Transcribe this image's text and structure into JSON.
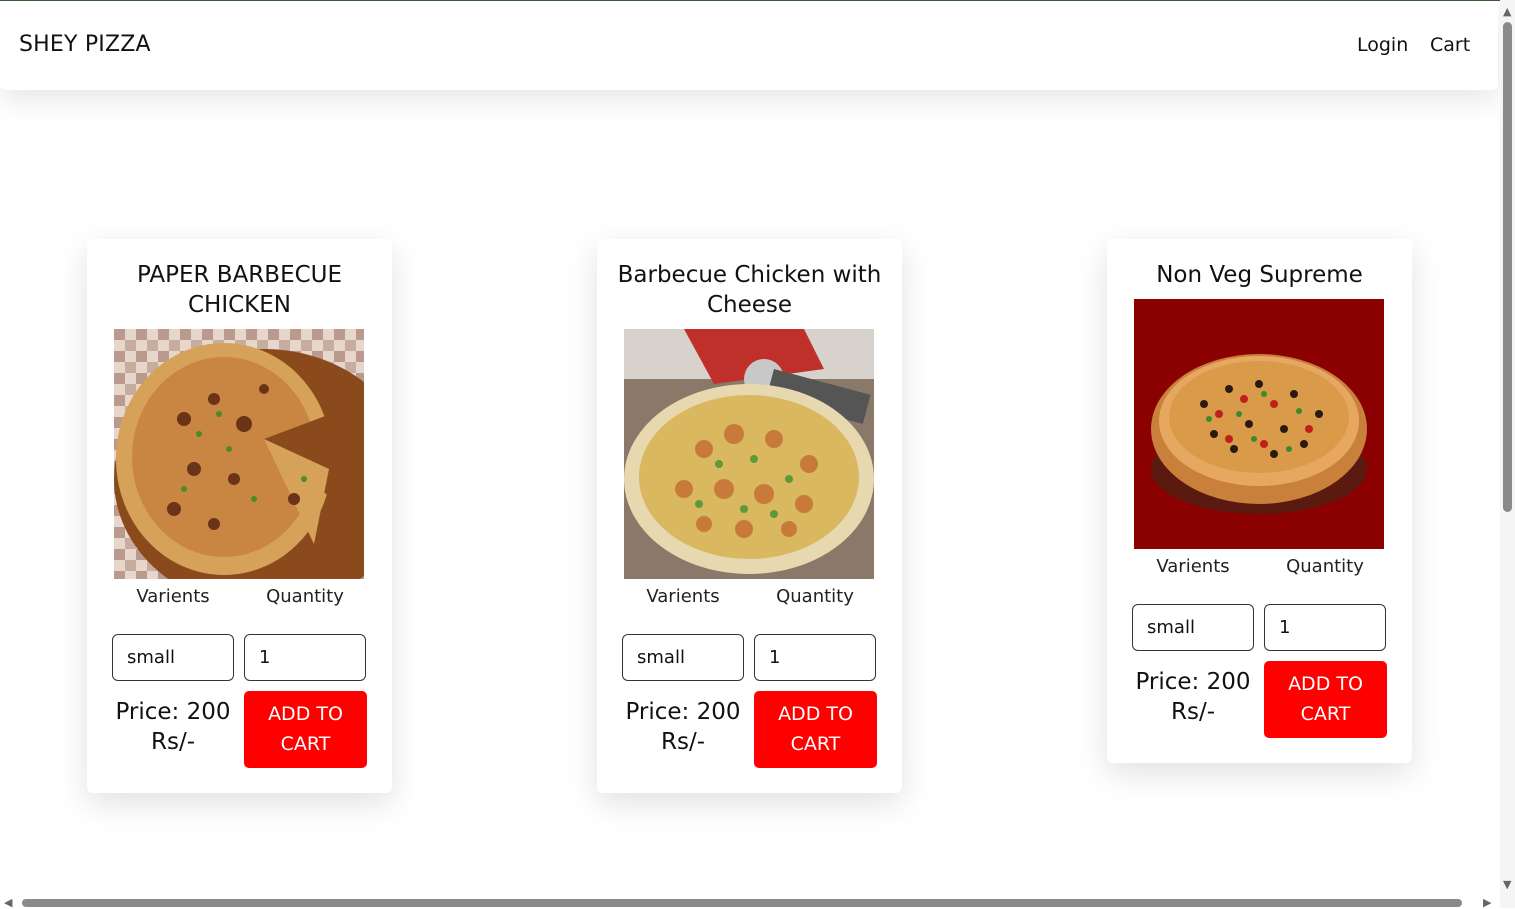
{
  "navbar": {
    "brand": "SHEY PIZZA",
    "links": [
      "Login",
      "Cart"
    ]
  },
  "pizzas": [
    {
      "title": "PAPER BARBECUE CHICKEN",
      "image_icon": "pizza-image",
      "varients_label": "Varients",
      "quantity_label": "Quantity",
      "varient_value": "small",
      "quantity_value": "1",
      "price_text": "Price: 200 Rs/-",
      "button_label": "ADD TO CART"
    },
    {
      "title": "Barbecue Chicken with Cheese",
      "image_icon": "pizza-image",
      "varients_label": "Varients",
      "quantity_label": "Quantity",
      "varient_value": "small",
      "quantity_value": "1",
      "price_text": "Price: 200 Rs/-",
      "button_label": "ADD TO CART"
    },
    {
      "title": "Non Veg Supreme",
      "image_icon": "pizza-image",
      "varients_label": "Varients",
      "quantity_label": "Quantity",
      "varient_value": "small",
      "quantity_value": "1",
      "price_text": "Price: 200 Rs/-",
      "button_label": "ADD TO CART"
    }
  ],
  "colors": {
    "accent_button": "#ff0000",
    "non_veg_bg": "#8b0000"
  }
}
